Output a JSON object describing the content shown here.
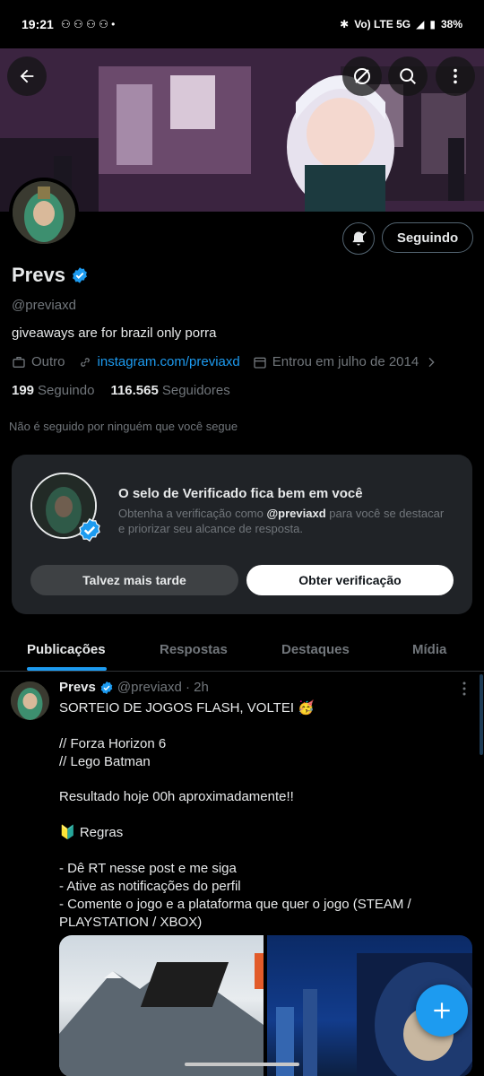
{
  "status_bar": {
    "time": "19:21",
    "notif_icons": "⚇ ⚇ ⚇ ⚇ •",
    "network": "Vo) LTE 5G",
    "battery": "38%"
  },
  "header": {
    "back_icon": "arrow-left-icon",
    "hide_icon": "eye-slash-icon",
    "search_icon": "search-icon",
    "more_icon": "more-vertical-icon"
  },
  "profile": {
    "name": "Prevs",
    "handle": "@previaxd",
    "bio": "giveaways are for brazil only porra",
    "category": "Outro",
    "link": "instagram.com/previaxd",
    "joined": "Entrou em julho de 2014",
    "following_count": "199",
    "following_label": "Seguindo",
    "followers_count": "116.565",
    "followers_label": "Seguidores",
    "not_followed_text": "Não é seguido por ninguém que você segue",
    "follow_button": "Seguindo"
  },
  "verify_card": {
    "title": "O selo de Verificado fica bem em você",
    "desc_before": "Obtenha a verificação como ",
    "desc_handle": "@previaxd",
    "desc_after": " para você se destacar e priorizar seu alcance de resposta.",
    "later_button": "Talvez mais tarde",
    "get_button": "Obter verificação"
  },
  "tabs": [
    {
      "label": "Publicações",
      "active": true
    },
    {
      "label": "Respostas",
      "active": false
    },
    {
      "label": "Destaques",
      "active": false
    },
    {
      "label": "Mídia",
      "active": false
    }
  ],
  "post": {
    "name": "Prevs",
    "handle_time": "@previaxd · 2h",
    "lines": [
      "SORTEIO DE JOGOS FLASH, VOLTEI 🥳",
      "",
      "// Forza Horizon 6",
      "// Lego Batman",
      "",
      "Resultado hoje 00h aproximadamente!!",
      "",
      "🔰 Regras",
      "",
      "- Dê RT nesse post e me siga",
      "- Ative as notificações do perfil",
      "- Comente o jogo e a plataforma que quer o jogo (STEAM /",
      "PLAYSTATION / XBOX)"
    ]
  },
  "colors": {
    "accent": "#1d9bf0",
    "background": "#000000",
    "muted": "#71767b",
    "card": "#202327"
  }
}
